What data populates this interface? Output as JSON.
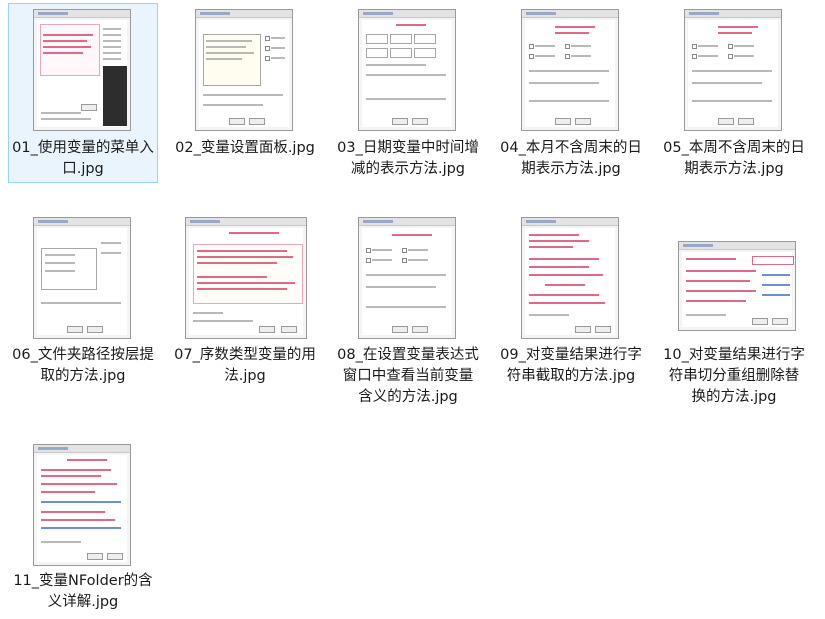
{
  "files": [
    {
      "label": "01_使用变量的菜单入口.jpg"
    },
    {
      "label": "02_变量设置面板.jpg"
    },
    {
      "label": "03_日期变量中时间增减的表示方法.jpg"
    },
    {
      "label": "04_本月不含周末的日期表示方法.jpg"
    },
    {
      "label": "05_本周不含周末的日期表示方法.jpg"
    },
    {
      "label": "06_文件夹路径按层提取的方法.jpg"
    },
    {
      "label": "07_序数类型变量的用法.jpg"
    },
    {
      "label": "08_在设置变量表达式窗口中查看当前变量含义的方法.jpg"
    },
    {
      "label": "09_对变量结果进行字符串截取的方法.jpg"
    },
    {
      "label": "10_对变量结果进行字符串切分重组删除替换的方法.jpg"
    },
    {
      "label": "11_变量NFolder的含义详解.jpg"
    }
  ],
  "colors": {
    "selection_border": "#99d1ff",
    "selection_fill": "#eaf4fd",
    "annotation_red": "#e06a86"
  }
}
